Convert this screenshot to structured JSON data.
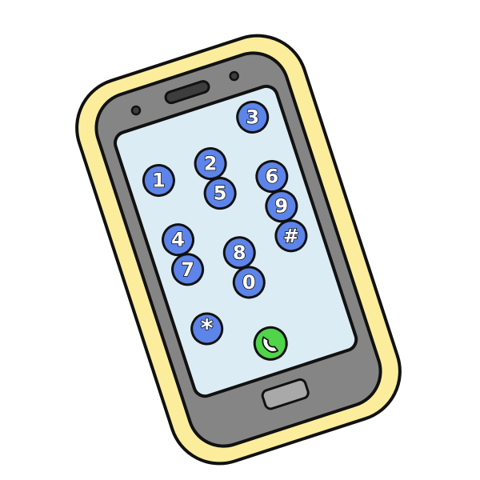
{
  "phone": {
    "colors": {
      "outline": "#111111",
      "case": "#fbed9c",
      "body": "#858585",
      "screen": "#dcecf4",
      "key": "#5d84e8",
      "key_text": "#ffffff",
      "call_key": "#4fd44a",
      "call_icon": "#ffffff",
      "home_button": "#a9a9a9",
      "earpiece": "#3d3d3d"
    },
    "keypad": {
      "rows": [
        [
          "",
          "",
          "3"
        ],
        [
          "1",
          "2",
          ""
        ],
        [
          "",
          "5",
          "6"
        ],
        [
          "4",
          "",
          "9"
        ],
        [
          "7",
          "8",
          "#"
        ],
        [
          "",
          "0",
          ""
        ],
        [
          "*",
          "",
          ""
        ]
      ],
      "call_key_icon": "phone-handset-icon"
    }
  }
}
